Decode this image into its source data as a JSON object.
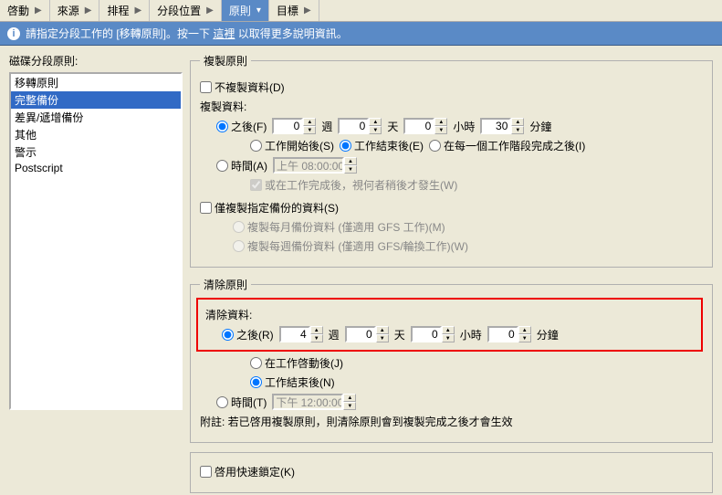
{
  "tabs": [
    {
      "label": "啓動"
    },
    {
      "label": "來源"
    },
    {
      "label": "排程"
    },
    {
      "label": "分段位置"
    },
    {
      "label": "原則",
      "active": true
    },
    {
      "label": "目標"
    }
  ],
  "info": {
    "pre": "請指定分段工作的 [移轉原則]。按一下",
    "link": "這裡",
    "post": "以取得更多說明資訊。"
  },
  "left": {
    "label": "磁碟分段原則:",
    "items": [
      "移轉原則",
      "完整備份",
      "差異/遞增備份",
      "其他",
      "警示",
      "Postscript"
    ],
    "selected": 1
  },
  "copyPolicy": {
    "legend": "複製原則",
    "noCopy": {
      "label": "不複製資料(D)",
      "hot": "D",
      "checked": false
    },
    "sectionLabel": "複製資料:",
    "after": {
      "label": "之後(F)",
      "hot": "F",
      "checked": true,
      "weeks": {
        "value": "0",
        "unit": "週"
      },
      "days": {
        "value": "0",
        "unit": "天"
      },
      "hours": {
        "value": "0",
        "unit": "小時"
      },
      "minutes": {
        "value": "30",
        "unit": "分鐘"
      }
    },
    "afterOptions": {
      "jobStart": {
        "label": "工作開始後(S)",
        "hot": "S",
        "checked": false
      },
      "jobEnd": {
        "label": "工作結束後(E)",
        "hot": "E",
        "checked": true
      },
      "eachStage": {
        "label": "在每一個工作階段完成之後(I)",
        "hot": "I",
        "checked": false
      }
    },
    "atTime": {
      "label": "時間(A)",
      "hot": "A",
      "checked": false,
      "value": "上午 08:00:00"
    },
    "orAfterJob": {
      "label": "或在工作完成後，視何者稍後才發生(W)",
      "hot": "W",
      "checked": true,
      "disabled": true
    },
    "onlySpecified": {
      "label": "僅複製指定備份的資料(S)",
      "hot": "S",
      "checked": false
    },
    "sub": {
      "monthly": {
        "label": "複製每月備份資料 (僅適用 GFS 工作)(M)",
        "hot": "M",
        "checked": false
      },
      "weekly": {
        "label": "複製每週備份資料 (僅適用 GFS/輪換工作)(W)",
        "hot": "W",
        "checked": false
      }
    }
  },
  "purgePolicy": {
    "legend": "清除原則",
    "sectionLabel": "清除資料:",
    "after": {
      "label": "之後(R)",
      "hot": "R",
      "checked": true,
      "weeks": {
        "value": "4",
        "unit": "週"
      },
      "days": {
        "value": "0",
        "unit": "天"
      },
      "hours": {
        "value": "0",
        "unit": "小時"
      },
      "minutes": {
        "value": "0",
        "unit": "分鐘"
      }
    },
    "afterOptions": {
      "jobStart": {
        "label": "在工作啓動後(J)",
        "hot": "J",
        "checked": false
      },
      "jobEnd": {
        "label": "工作結束後(N)",
        "hot": "N",
        "checked": true
      }
    },
    "atTime": {
      "label": "時間(T)",
      "hot": "T",
      "checked": false,
      "value": "下午 12:00:00"
    },
    "note": "附註: 若已啓用複製原則，則清除原則會到複製完成之後才會生效"
  },
  "quickLock": {
    "label": "啓用快速鎖定(K)",
    "hot": "K",
    "checked": false
  }
}
